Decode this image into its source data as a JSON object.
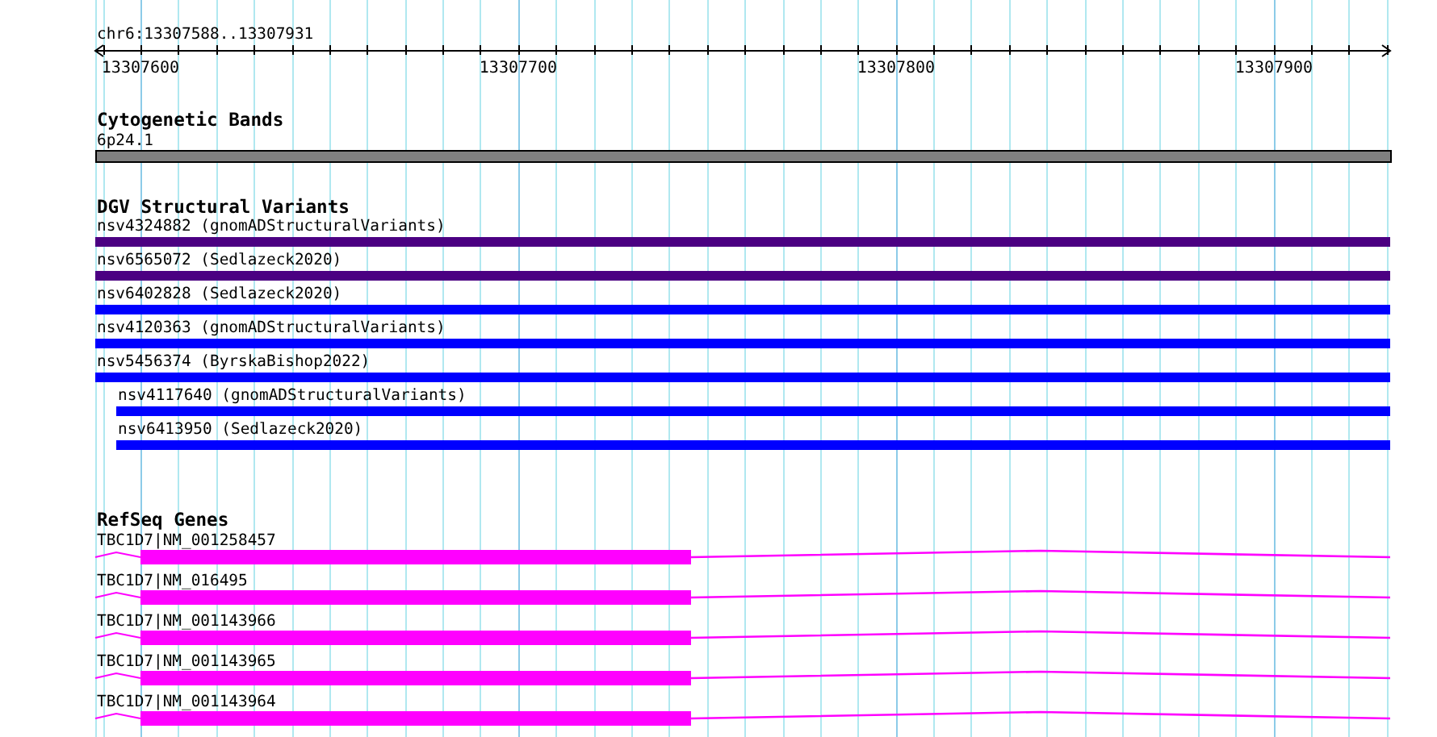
{
  "ruler": {
    "location": "chr6:13307588..13307931",
    "ticks": [
      "13307600",
      "13307700",
      "13307800",
      "13307900"
    ]
  },
  "tracks": [
    {
      "kind": "band",
      "title": "Cytogenetic Bands",
      "features": [
        {
          "label": "6p24.1",
          "color": "#808080"
        }
      ]
    },
    {
      "kind": "variant",
      "title": "DGV Structural Variants",
      "features": [
        {
          "label": "nsv4324882 (gnomADStructuralVariants)",
          "color": "#4b0082",
          "nested": false
        },
        {
          "label": "nsv6565072 (Sedlazeck2020)",
          "color": "#4b0082",
          "nested": false
        },
        {
          "label": "nsv6402828 (Sedlazeck2020)",
          "color": "#0000ff",
          "nested": false
        },
        {
          "label": "nsv4120363 (gnomADStructuralVariants)",
          "color": "#0000ff",
          "nested": false
        },
        {
          "label": "nsv5456374 (ByrskaBishop2022)",
          "color": "#0000ff",
          "nested": false
        },
        {
          "label": "nsv4117640 (gnomADStructuralVariants)",
          "color": "#0000ff",
          "nested": true
        },
        {
          "label": "nsv6413950 (Sedlazeck2020)",
          "color": "#0000ff",
          "nested": true
        }
      ]
    },
    {
      "kind": "gene",
      "title": "RefSeq Genes",
      "features": [
        {
          "label": "TBC1D7|NM_001258457"
        },
        {
          "label": "TBC1D7|NM_016495"
        },
        {
          "label": "TBC1D7|NM_001143966"
        },
        {
          "label": "TBC1D7|NM_001143965"
        },
        {
          "label": "TBC1D7|NM_001143964"
        }
      ]
    }
  ]
}
